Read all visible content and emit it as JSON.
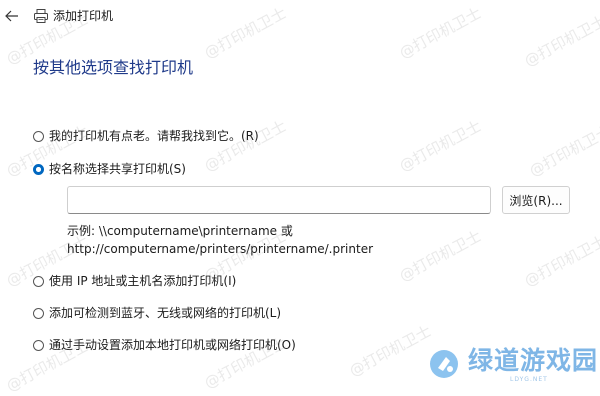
{
  "window": {
    "title": "添加打印机"
  },
  "page": {
    "heading": "按其他选项查找打印机"
  },
  "options": [
    {
      "label": "我的打印机有点老。请帮我找到它。(R)",
      "selected": false
    },
    {
      "label": "按名称选择共享打印机(S)",
      "selected": true
    },
    {
      "label": "使用 IP 地址或主机名添加打印机(I)",
      "selected": false
    },
    {
      "label": "添加可检测到蓝牙、无线或网络的打印机(L)",
      "selected": false
    },
    {
      "label": "通过手动设置添加本地打印机或网络打印机(O)",
      "selected": false
    }
  ],
  "shared_printer": {
    "value": "",
    "browse_label": "浏览(R)...",
    "example_line1": "示例: \\\\computername\\printername 或",
    "example_line2": "http://computername/printers/printername/.printer"
  },
  "watermark": {
    "text": "@打印机卫士"
  },
  "logo": {
    "name": "绿道游戏园",
    "sub": "LDYG.NET"
  },
  "colors": {
    "accent": "#0067c0",
    "heading": "#1f3a8a"
  }
}
